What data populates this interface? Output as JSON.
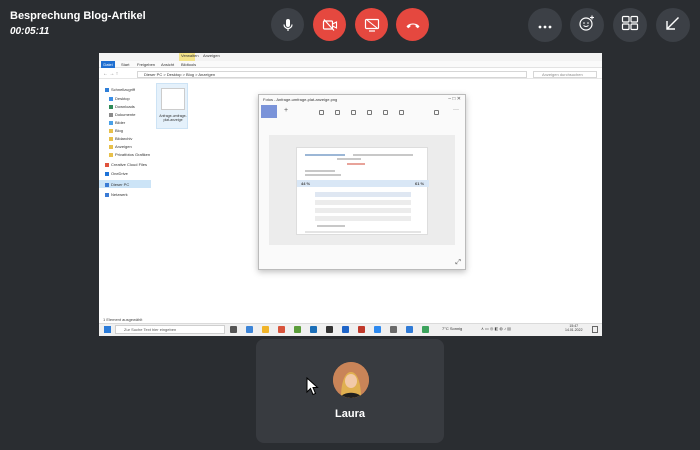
{
  "meeting": {
    "title": "Besprechung Blog-Artikel",
    "timer": "00:05:11"
  },
  "controls": {
    "center": [
      {
        "name": "microphone",
        "icon": "microphone-icon",
        "color": "#3c4046"
      },
      {
        "name": "camera-off",
        "icon": "camera-off-icon",
        "color": "#e5483f"
      },
      {
        "name": "screen-share",
        "icon": "screen-share-icon",
        "color": "#e5483f"
      },
      {
        "name": "hang-up",
        "icon": "hang-up-icon",
        "color": "#e5483f"
      }
    ],
    "right": [
      {
        "name": "more-options",
        "icon": "more-horizontal-icon"
      },
      {
        "name": "reactions",
        "icon": "emoji-add-icon"
      },
      {
        "name": "layout",
        "icon": "grid-layout-icon"
      },
      {
        "name": "minimize",
        "icon": "minimize-arrow-icon"
      }
    ]
  },
  "shared_screen": {
    "explorer": {
      "ribbon_tabs": [
        "Datei",
        "Start",
        "Freigeben",
        "Ansicht",
        "Bildtools"
      ],
      "ribbon_context": [
        "Verwalten",
        "Anzeigen"
      ],
      "address": "Dieser PC > Desktop > Blog > Anzeigen",
      "search_placeholder": "Anzeigen durchsuchen",
      "nav_items": [
        {
          "label": "Schnellzugriff",
          "icon": "star-icon"
        },
        {
          "label": "Desktop",
          "icon": "folder-icon"
        },
        {
          "label": "Downloads",
          "icon": "download-icon"
        },
        {
          "label": "Dokumente",
          "icon": "folder-icon"
        },
        {
          "label": "Bilder",
          "icon": "folder-icon"
        },
        {
          "label": "Blog",
          "icon": "folder-icon"
        },
        {
          "label": "Bildarchiv",
          "icon": "folder-icon"
        },
        {
          "label": "Anzeigen",
          "icon": "folder-icon"
        },
        {
          "label": "Privatfotos Grafiken",
          "icon": "folder-icon"
        },
        {
          "label": "Creative Cloud Files",
          "icon": "cloud-icon"
        },
        {
          "label": "OneDrive",
          "icon": "cloud-icon"
        },
        {
          "label": "Dieser PC",
          "icon": "computer-icon"
        },
        {
          "label": "Netzwerk",
          "icon": "network-icon"
        }
      ],
      "thumbnail_label": "Anfrage-umfrage-plat-anzeige",
      "status": "1 Element ausgewählt"
    },
    "viewer": {
      "title": "Fotos - Anfrage-umfrage-plat-anzeige.png",
      "percent": "44 %",
      "percent_right": "61 %"
    },
    "taskbar": {
      "search_placeholder": "Zur Suche Text hier eingeben",
      "weather": "7°C Sonnig",
      "time": "15:47",
      "date": "14.01.2022"
    }
  },
  "participant": {
    "name": "Laura",
    "avatar": "avatar-photo"
  }
}
